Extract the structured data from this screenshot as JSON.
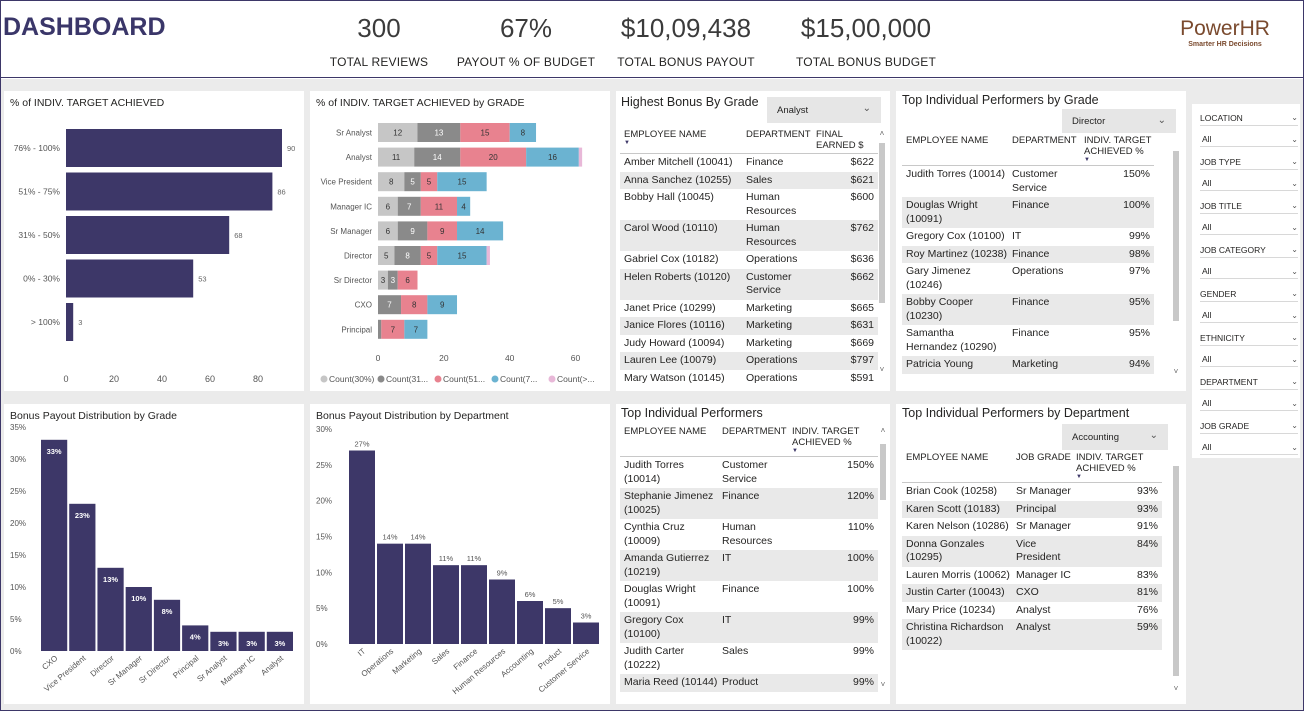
{
  "header": {
    "title": "DASHBOARD",
    "kpis": [
      {
        "value": "300",
        "label": "TOTAL REVIEWS"
      },
      {
        "value": "67%",
        "label": "PAYOUT % OF BUDGET"
      },
      {
        "value": "$10,09,438",
        "label": "TOTAL BONUS PAYOUT"
      },
      {
        "value": "$15,00,000",
        "label": "TOTAL BONUS BUDGET"
      }
    ],
    "logo": {
      "name": "PowerHR",
      "tagline": "Smarter HR Decisions"
    }
  },
  "colors": {
    "primary_bar": "#3d3768",
    "seg_30": "#c6c6c6",
    "seg_31_50": "#8a8a8a",
    "seg_51_75": "#e8828f",
    "seg_76_100": "#6bb3d1",
    "seg_gt100": "#e8b8d8"
  },
  "chart_data": [
    {
      "id": "target-achieved",
      "type": "bar",
      "orientation": "horizontal",
      "title": "% of INDIV. TARGET ACHIEVED",
      "categories": [
        "76% - 100%",
        "51% - 75%",
        "31% - 50%",
        "0% - 30%",
        "> 100%"
      ],
      "values": [
        90,
        86,
        68,
        53,
        3
      ],
      "xlim": [
        0,
        95
      ],
      "xticks": [
        0,
        20,
        40,
        60,
        80
      ]
    },
    {
      "id": "target-by-grade",
      "type": "bar",
      "orientation": "horizontal",
      "stacked": true,
      "title": "% of INDIV. TARGET ACHIEVED by GRADE",
      "categories": [
        "Sr Analyst",
        "Analyst",
        "Vice President",
        "Manager IC",
        "Sr Manager",
        "Director",
        "Sr Director",
        "CXO",
        "Principal"
      ],
      "series": [
        {
          "name": "Count(30%)",
          "values": [
            12,
            11,
            8,
            6,
            6,
            5,
            3,
            0,
            0
          ]
        },
        {
          "name": "Count(31...",
          "values": [
            13,
            14,
            5,
            7,
            9,
            8,
            3,
            7,
            1
          ]
        },
        {
          "name": "Count(51...",
          "values": [
            15,
            20,
            5,
            11,
            9,
            5,
            6,
            8,
            7
          ]
        },
        {
          "name": "Count(7...",
          "values": [
            8,
            16,
            15,
            4,
            14,
            15,
            0,
            9,
            7
          ]
        },
        {
          "name": "Count(>...",
          "values": [
            0,
            1,
            0,
            0,
            0,
            1,
            0,
            0,
            0
          ]
        }
      ],
      "xlim": [
        0,
        65
      ],
      "xticks": [
        0,
        20,
        40,
        60
      ]
    },
    {
      "id": "payout-by-grade",
      "type": "bar",
      "title": "Bonus Payout Distribution by Grade",
      "categories": [
        "CXO",
        "Vice President",
        "Director",
        "Sr Manager",
        "Sr Director",
        "Principal",
        "Sr Analyst",
        "Manager IC",
        "Analyst"
      ],
      "values": [
        33,
        23,
        13,
        10,
        8,
        4,
        3,
        3,
        3
      ],
      "value_suffix": "%",
      "ylim": [
        0,
        35
      ],
      "yticks": [
        "0%",
        "5%",
        "10%",
        "15%",
        "20%",
        "25%",
        "30%",
        "35%"
      ]
    },
    {
      "id": "payout-by-department",
      "type": "bar",
      "title": "Bonus Payout Distribution by Department",
      "categories": [
        "IT",
        "Operations",
        "Marketing",
        "Sales",
        "Finance",
        "Human Resources",
        "Accounting",
        "Product",
        "Customer Service"
      ],
      "values": [
        27,
        14,
        14,
        11,
        11,
        9,
        6,
        5,
        3
      ],
      "value_suffix": "%",
      "ylim": [
        0,
        30
      ],
      "yticks": [
        "0%",
        "5%",
        "10%",
        "15%",
        "20%",
        "25%",
        "30%"
      ]
    }
  ],
  "tables": {
    "highest_bonus": {
      "title": "Highest Bonus By Grade",
      "filter": "Analyst",
      "columns": [
        "EMPLOYEE NAME",
        "DEPARTMENT",
        "FINAL EARNED $"
      ],
      "rows": [
        [
          "Amber Mitchell (10041)",
          "Finance",
          "$622"
        ],
        [
          "Anna Sanchez (10255)",
          "Sales",
          "$621"
        ],
        [
          "Bobby Hall (10045)",
          "Human Resources",
          "$600"
        ],
        [
          "Carol Wood (10110)",
          "Human Resources",
          "$762"
        ],
        [
          "Gabriel Cox (10182)",
          "Operations",
          "$636"
        ],
        [
          "Helen Roberts (10120)",
          "Customer Service",
          "$662"
        ],
        [
          "Janet Price (10299)",
          "Marketing",
          "$665"
        ],
        [
          "Janice Flores (10116)",
          "Marketing",
          "$631"
        ],
        [
          "Judy Howard (10094)",
          "Marketing",
          "$669"
        ],
        [
          "Lauren Lee (10079)",
          "Operations",
          "$797"
        ],
        [
          "Mary Watson (10145)",
          "Operations",
          "$591"
        ]
      ]
    },
    "top_by_grade": {
      "title": "Top Individual Performers by Grade",
      "filter": "Director",
      "columns": [
        "EMPLOYEE NAME",
        "DEPARTMENT",
        "INDIV. TARGET ACHIEVED %"
      ],
      "rows": [
        [
          "Judith Torres (10014)",
          "Customer Service",
          "150%"
        ],
        [
          "Douglas Wright (10091)",
          "Finance",
          "100%"
        ],
        [
          "Gregory Cox (10100)",
          "IT",
          "99%"
        ],
        [
          "Roy Martinez (10238)",
          "Finance",
          "98%"
        ],
        [
          "Gary Jimenez (10246)",
          "Operations",
          "97%"
        ],
        [
          "Bobby Cooper (10230)",
          "Finance",
          "95%"
        ],
        [
          "Samantha Hernandez (10290)",
          "Finance",
          "95%"
        ],
        [
          "Patricia Young",
          "Marketing",
          "94%"
        ]
      ]
    },
    "top_performers": {
      "title": "Top Individual Performers",
      "columns": [
        "EMPLOYEE NAME",
        "DEPARTMENT",
        "INDIV. TARGET ACHIEVED %"
      ],
      "rows": [
        [
          "Judith Torres (10014)",
          "Customer Service",
          "150%"
        ],
        [
          "Stephanie Jimenez (10025)",
          "Finance",
          "120%"
        ],
        [
          "Cynthia Cruz (10009)",
          "Human Resources",
          "110%"
        ],
        [
          "Amanda Gutierrez (10219)",
          "IT",
          "100%"
        ],
        [
          "Douglas Wright (10091)",
          "Finance",
          "100%"
        ],
        [
          "Gregory Cox (10100)",
          "IT",
          "99%"
        ],
        [
          "Judith Carter (10222)",
          "Sales",
          "99%"
        ],
        [
          "Maria Reed (10144)",
          "Product",
          "99%"
        ]
      ]
    },
    "top_by_department": {
      "title": "Top Individual Performers by Department",
      "filter": "Accounting",
      "columns": [
        "EMPLOYEE NAME",
        "JOB GRADE",
        "INDIV. TARGET ACHIEVED %"
      ],
      "rows": [
        [
          "Brian Cook (10258)",
          "Sr Manager",
          "93%"
        ],
        [
          "Karen Scott (10183)",
          "Principal",
          "93%"
        ],
        [
          "Karen Nelson (10286)",
          "Sr Manager",
          "91%"
        ],
        [
          "Donna Gonzales (10295)",
          "Vice President",
          "84%"
        ],
        [
          "Lauren Morris (10062)",
          "Manager IC",
          "83%"
        ],
        [
          "Justin Carter (10043)",
          "CXO",
          "81%"
        ],
        [
          "Mary Price (10234)",
          "Analyst",
          "76%"
        ],
        [
          "Christina Richardson (10022)",
          "Analyst",
          "59%"
        ]
      ]
    }
  },
  "slicers": [
    {
      "label": "LOCATION",
      "value": "All"
    },
    {
      "label": "JOB TYPE",
      "value": "All"
    },
    {
      "label": "JOB TITLE",
      "value": "All"
    },
    {
      "label": "JOB CATEGORY",
      "value": "All"
    },
    {
      "label": "GENDER",
      "value": "All"
    },
    {
      "label": "ETHNICITY",
      "value": "All"
    },
    {
      "label": "DEPARTMENT",
      "value": "All"
    },
    {
      "label": "JOB GRADE",
      "value": "All"
    }
  ]
}
